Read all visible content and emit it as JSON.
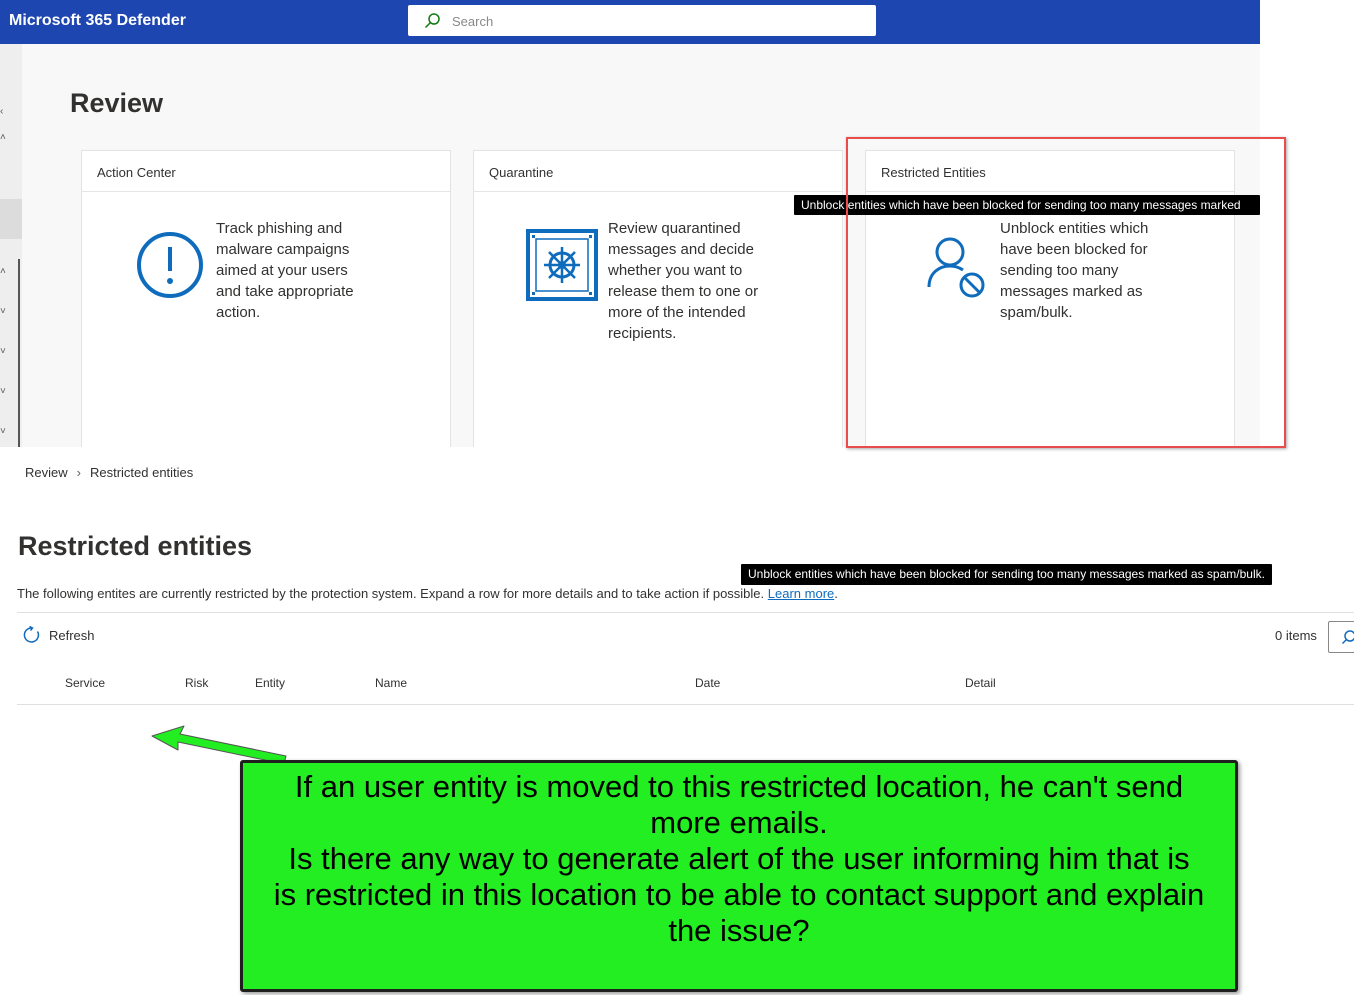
{
  "top_screenshot": {
    "app_title": "Microsoft 365 Defender",
    "search": {
      "placeholder": "Search",
      "value": ""
    },
    "page_title": "Review",
    "cards": [
      {
        "title": "Action Center",
        "icon": "alert-circle-icon",
        "description": "Track phishing and malware campaigns aimed at your users and take appropriate action."
      },
      {
        "title": "Quarantine",
        "icon": "vault-icon",
        "description": "Review quarantined messages and decide whether you want to release them to one or more of the intended recipients."
      },
      {
        "title": "Restricted Entities",
        "icon": "blocked-user-icon",
        "description": "Unblock entities which have been blocked for sending too many messages marked as spam/bulk."
      }
    ],
    "tooltip": "Unblock entities which have been blocked for sending too many messages marked",
    "highlight_color": "#e84c4c"
  },
  "bottom_screenshot": {
    "breadcrumb": {
      "parent": "Review",
      "current": "Restricted entities"
    },
    "page_title": "Restricted entities",
    "tooltip": "Unblock entities which have been blocked for sending too many messages marked as spam/bulk.",
    "description": "The following entites are currently restricted by the protection system. Expand a row for more details and to take action if possible.",
    "learn_more": "Learn more",
    "description_end": ".",
    "toolbar": {
      "refresh_label": "Refresh",
      "item_count": "0 items"
    },
    "columns": [
      "Service",
      "Risk",
      "Entity",
      "Name",
      "Date",
      "Detail"
    ],
    "rows": []
  },
  "annotation": {
    "lines": [
      "If an user entity is moved to this restricted location, he can't send more emails.",
      "Is there any way to generate alert of the user informing him that is is restricted in this location to be able to contact support and explain the issue?"
    ],
    "color": "#22ee22"
  },
  "colors": {
    "brand": "#1d46b1",
    "icon_blue": "#0f6cbd",
    "link": "#0f6cbd"
  }
}
